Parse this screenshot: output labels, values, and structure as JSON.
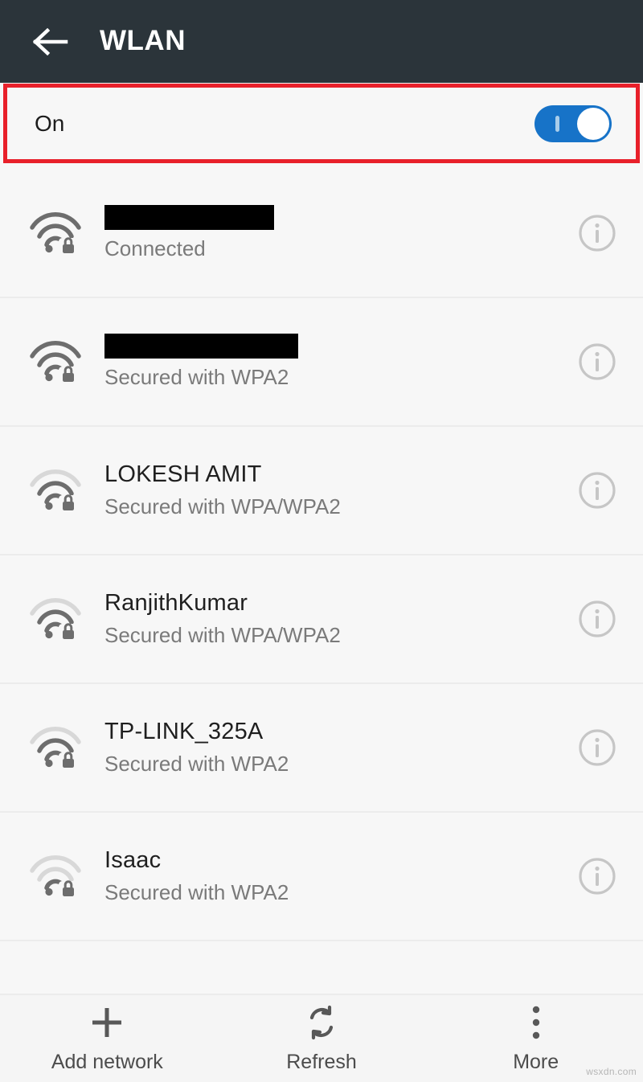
{
  "header": {
    "back_icon": "arrow-left-icon",
    "title": "WLAN",
    "background": "#2b343a"
  },
  "master_switch": {
    "label": "On",
    "state": "on",
    "accent_color": "#1773c8",
    "highlight_color": "#e8202a"
  },
  "networks": [
    {
      "name": "",
      "redacted": true,
      "redaction_width": 211,
      "status": "Connected",
      "signal_bars": 3,
      "secured": true,
      "icon": "wifi-lock-icon",
      "info_icon": "info-icon"
    },
    {
      "name": "",
      "redacted": true,
      "redaction_width": 241,
      "status": "Secured with WPA2",
      "signal_bars": 3,
      "secured": true,
      "icon": "wifi-lock-icon",
      "info_icon": "info-icon"
    },
    {
      "name": "LOKESH AMIT",
      "redacted": false,
      "status": "Secured with WPA/WPA2",
      "signal_bars": 2,
      "secured": true,
      "icon": "wifi-lock-icon",
      "info_icon": "info-icon"
    },
    {
      "name": "RanjithKumar",
      "redacted": false,
      "status": "Secured with WPA/WPA2",
      "signal_bars": 2,
      "secured": true,
      "icon": "wifi-lock-icon",
      "info_icon": "info-icon"
    },
    {
      "name": "TP-LINK_325A",
      "redacted": false,
      "status": "Secured with WPA2",
      "signal_bars": 2,
      "secured": true,
      "icon": "wifi-lock-icon",
      "info_icon": "info-icon"
    },
    {
      "name": "Isaac",
      "redacted": false,
      "status": "Secured with WPA2",
      "signal_bars": 1,
      "secured": true,
      "icon": "wifi-lock-icon",
      "info_icon": "info-icon"
    }
  ],
  "bottom_bar": {
    "items": [
      {
        "label": "Add network",
        "icon": "plus-icon"
      },
      {
        "label": "Refresh",
        "icon": "refresh-icon"
      },
      {
        "label": "More",
        "icon": "overflow-menu-icon"
      }
    ]
  },
  "watermark": "wsxdn.com"
}
